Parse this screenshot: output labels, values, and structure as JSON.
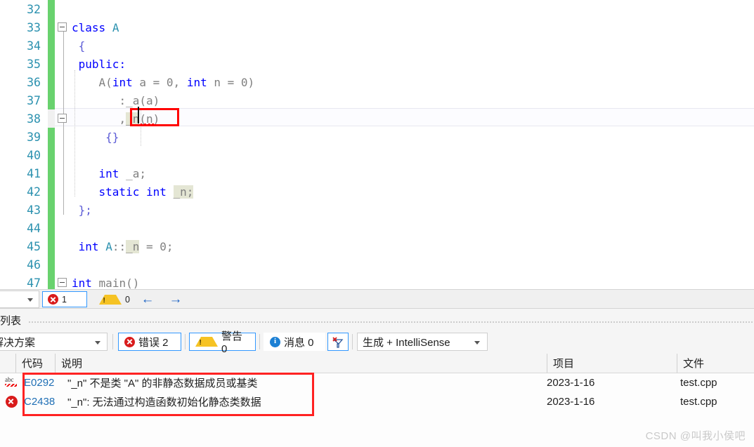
{
  "editor": {
    "lines": [
      {
        "no": "32",
        "text": "",
        "tokens": []
      },
      {
        "no": "33",
        "text": "class A",
        "tokens": []
      },
      {
        "no": "34",
        "text": "{",
        "tokens": []
      },
      {
        "no": "35",
        "text": "public:",
        "tokens": []
      },
      {
        "no": "36",
        "text": "A(int a = 0, int n = 0)",
        "tokens": []
      },
      {
        "no": "37",
        "text": ":_a(a)",
        "tokens": []
      },
      {
        "no": "38",
        "text": ",_n(n)",
        "tokens": []
      },
      {
        "no": "39",
        "text": "{}",
        "tokens": []
      },
      {
        "no": "40",
        "text": "",
        "tokens": []
      },
      {
        "no": "41",
        "text": "int _a;",
        "tokens": []
      },
      {
        "no": "42",
        "text": "static int _n;",
        "tokens": []
      },
      {
        "no": "43",
        "text": "};",
        "tokens": []
      },
      {
        "no": "44",
        "text": "",
        "tokens": []
      },
      {
        "no": "45",
        "text": "int A::_n = 0;",
        "tokens": []
      },
      {
        "no": "46",
        "text": "",
        "tokens": []
      },
      {
        "no": "47",
        "text": "int main()",
        "tokens": []
      }
    ],
    "line_numbers": [
      "32",
      "33",
      "34",
      "35",
      "36",
      "37",
      "38",
      "39",
      "40",
      "41",
      "42",
      "43",
      "44",
      "45",
      "46",
      "47"
    ],
    "tok": {
      "class_kw": "class",
      "class_name": "A",
      "open_brace": "{",
      "public": "public:",
      "ctor_name": "A",
      "lparen": "(",
      "int": "int",
      "a": "a",
      "eq": " = ",
      "zero": "0",
      "comma_sp": ", ",
      "n": "n",
      "rparen": ")",
      "init_colon": ":",
      "_a": "_a",
      "a_paren": "(a)",
      "init_comma": ",",
      "_n": "_n",
      "n_paren": "(n)",
      "empty_body": "{}",
      "int_a_decl": "_a;",
      "static": "static",
      "int_n_decl": "_n;",
      "close_class": "};",
      "scope_A": "A",
      "scope_op": "::",
      "def_tail": " = 0;",
      "main": "main()"
    }
  },
  "statusbar": {
    "error_count": "1",
    "warning_count": "0",
    "prev_label": "←",
    "next_label": "→"
  },
  "errorlist": {
    "title": "列表",
    "scope": "个解决方案",
    "errors_label": "错误 2",
    "warnings_label": "警告 0",
    "messages_label": "消息 0",
    "build_filter": "生成 + IntelliSense",
    "columns": [
      "",
      "代码",
      "说明",
      "项目",
      "文件"
    ],
    "rows": [
      {
        "icon": "intellisense-icon",
        "code": "E0292",
        "description": "\"_n\" 不是类 \"A\" 的非静态数据成员或基类",
        "project": "2023-1-16",
        "file": "test.cpp"
      },
      {
        "icon": "error-icon",
        "code": "C2438",
        "description": "\"_n\": 无法通过构造函数初始化静态类数据",
        "project": "2023-1-16",
        "file": "test.cpp"
      }
    ]
  },
  "watermark": "CSDN @叫我小侯吧",
  "colors": {
    "keyword": "#0000ff",
    "class": "#2B91AF",
    "identifier": "#808080",
    "linenumber": "#2B91AF",
    "changebar": "#69d26e",
    "error_red": "#d91b1b",
    "annotation_red": "#ff0000",
    "accent_blue": "#3399ff",
    "code_link": "#1f6fb5"
  }
}
